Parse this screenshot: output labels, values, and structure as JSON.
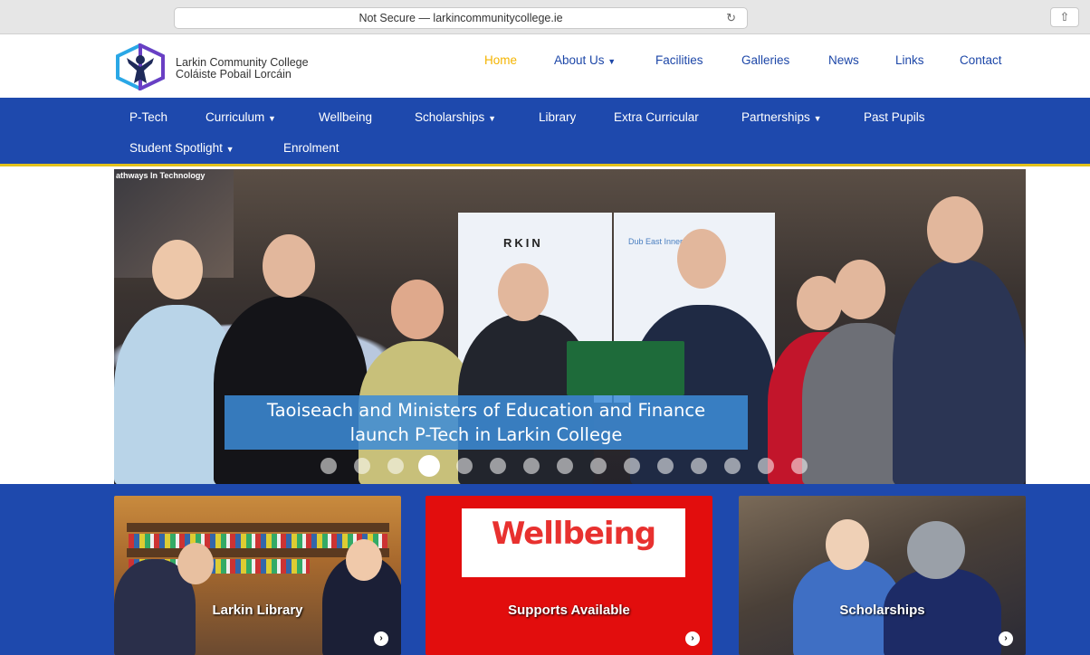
{
  "browser": {
    "url_text": "Not Secure — larkincommunitycollege.ie",
    "reload_glyph": "↻",
    "share_glyph": "⇧",
    "icons": [
      "reload-icon",
      "share-icon"
    ]
  },
  "brand": {
    "name_en": "Larkin Community College",
    "name_ga": "Coláiste Pobail Lorcáin",
    "logo_colors": [
      "#2aa7e6",
      "#6a3fc4",
      "#1e2a5a"
    ]
  },
  "top_nav": {
    "items": [
      {
        "label": "Home",
        "active": true
      },
      {
        "label": "About Us",
        "dropdown": true
      },
      {
        "label": "Facilities"
      },
      {
        "label": "Galleries"
      },
      {
        "label": "News"
      },
      {
        "label": "Links"
      },
      {
        "label": "Contact"
      }
    ],
    "caret": "▼"
  },
  "sub_nav": {
    "row1": [
      "P-Tech",
      "Curriculum",
      "Wellbeing",
      "Scholarships",
      "Library",
      "Extra Curricular",
      "Partnerships",
      "Past Pupils"
    ],
    "row2": [
      "Student Spotlight",
      "Enrolment"
    ]
  },
  "hero": {
    "banner_tag": "athways In Technology",
    "rollup_text": "RKIN",
    "rollup_text_b": "Dub  East Inner City",
    "caption_line1": "Taoiseach and Ministers of Education and Finance",
    "caption_line2": "launch P-Tech in Larkin College",
    "slide_count": 15,
    "active_slide": 4
  },
  "cards": [
    {
      "label": "Larkin Library"
    },
    {
      "label": "Supports Available",
      "sign_text": "Wellbeing"
    },
    {
      "label": "Scholarships"
    }
  ],
  "arrow_glyph": "›",
  "colors": {
    "brand_blue": "#1e49ad",
    "accent_yellow": "#f4b400",
    "wellbeing_red": "#e20d0d"
  }
}
